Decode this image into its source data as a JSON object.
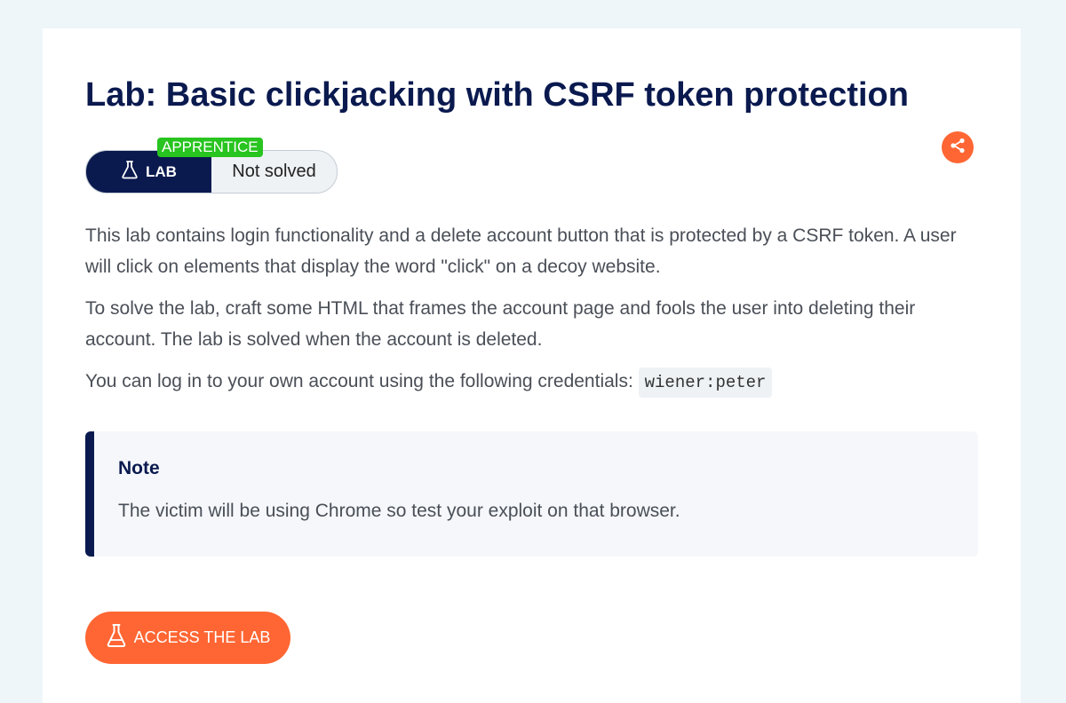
{
  "page": {
    "title": "Lab: Basic clickjacking with CSRF token protection"
  },
  "badge": {
    "level": "APPRENTICE",
    "lab_label": "LAB",
    "status": "Not solved"
  },
  "share": {
    "icon": "share-icon"
  },
  "description": {
    "p1": "This lab contains login functionality and a delete account button that is protected by a CSRF token. A user will click on elements that display the word \"click\" on a decoy website.",
    "p2": "To solve the lab, craft some HTML that frames the account page and fools the user into deleting their account. The lab is solved when the account is deleted.",
    "p3_prefix": "You can log in to your own account using the following credentials: ",
    "credentials": "wiener:peter"
  },
  "note": {
    "title": "Note",
    "text": "The victim will be using Chrome so test your exploit on that browser."
  },
  "cta": {
    "label": "ACCESS THE LAB",
    "icon": "flask-icon"
  },
  "colors": {
    "navy": "#0a1a4f",
    "orange": "#ff6633",
    "green": "#28c41f",
    "background": "#eef6f9"
  }
}
